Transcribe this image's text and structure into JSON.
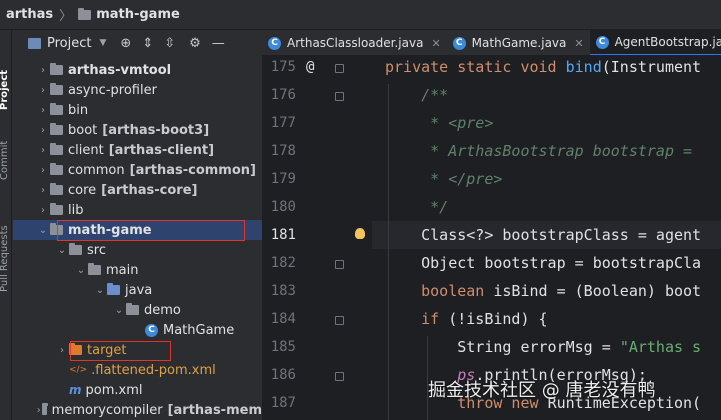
{
  "breadcrumb": {
    "root": "arthas",
    "sep": "〉",
    "module": "math-game"
  },
  "side_stripe": {
    "project": "Project",
    "commit": "Commit",
    "pull_requests": "Pull Requests"
  },
  "project_panel": {
    "title": "Project"
  },
  "tree": [
    {
      "label": "arthas-vmtool",
      "suffix": "",
      "arrow": "›",
      "icon": "folder",
      "indent": 1,
      "bold": true
    },
    {
      "label": "async-profiler",
      "suffix": "",
      "arrow": "›",
      "icon": "folder",
      "indent": 1,
      "bold": false
    },
    {
      "label": "bin",
      "suffix": "",
      "arrow": "›",
      "icon": "folder",
      "indent": 1,
      "bold": false
    },
    {
      "label": "boot",
      "suffix": "[arthas-boot3]",
      "arrow": "›",
      "icon": "folder",
      "indent": 1,
      "bold": false
    },
    {
      "label": "client",
      "suffix": "[arthas-client]",
      "arrow": "›",
      "icon": "folder",
      "indent": 1,
      "bold": false
    },
    {
      "label": "common",
      "suffix": "[arthas-common]",
      "arrow": "›",
      "icon": "folder",
      "indent": 1,
      "bold": false
    },
    {
      "label": "core",
      "suffix": "[arthas-core]",
      "arrow": "›",
      "icon": "folder",
      "indent": 1,
      "bold": false
    },
    {
      "label": "lib",
      "suffix": "",
      "arrow": "›",
      "icon": "folder",
      "indent": 1,
      "bold": false
    },
    {
      "label": "math-game",
      "suffix": "",
      "arrow": "⌄",
      "icon": "folder",
      "indent": 1,
      "bold": true,
      "selected": true
    },
    {
      "label": "src",
      "suffix": "",
      "arrow": "⌄",
      "icon": "folder",
      "indent": 2,
      "bold": false
    },
    {
      "label": "main",
      "suffix": "",
      "arrow": "⌄",
      "icon": "folder",
      "indent": 3,
      "bold": false
    },
    {
      "label": "java",
      "suffix": "",
      "arrow": "⌄",
      "icon": "folder-blue",
      "indent": 4,
      "bold": false
    },
    {
      "label": "demo",
      "suffix": "",
      "arrow": "⌄",
      "icon": "package",
      "indent": 5,
      "bold": false
    },
    {
      "label": "MathGame",
      "suffix": "",
      "arrow": "",
      "icon": "class",
      "indent": 6,
      "bold": false
    },
    {
      "label": "target",
      "suffix": "",
      "arrow": "›",
      "icon": "folder-orange",
      "indent": 2,
      "bold": false,
      "excluded": true
    },
    {
      "label": ".flattened-pom.xml",
      "suffix": "",
      "arrow": "",
      "icon": "xml",
      "indent": 2,
      "bold": false,
      "excluded": true
    },
    {
      "label": "pom.xml",
      "suffix": "",
      "arrow": "",
      "icon": "maven",
      "indent": 2,
      "bold": false
    },
    {
      "label": "memorycompiler",
      "suffix": "[arthas-mem",
      "arrow": "›",
      "icon": "folder",
      "indent": 1,
      "bold": false
    }
  ],
  "tabs": [
    {
      "label": "ArthasClassloader.java",
      "active": false
    },
    {
      "label": "MathGame.java",
      "active": false
    },
    {
      "label": "AgentBootstrap.java",
      "active": true
    }
  ],
  "line_numbers": [
    "175",
    "176",
    "177",
    "178",
    "179",
    "180",
    "181",
    "182",
    "183",
    "184",
    "185",
    "186",
    "187"
  ],
  "current_line": "181",
  "code_lines": [
    [
      {
        "t": "private static void ",
        "c": "kw"
      },
      {
        "t": "bind",
        "c": "fn"
      },
      {
        "t": "(Instrument",
        "c": ""
      }
    ],
    [
      {
        "t": "    /**",
        "c": "doc"
      }
    ],
    [
      {
        "t": "     * <pre>",
        "c": "doc"
      }
    ],
    [
      {
        "t": "     * ArthasBootstrap bootstrap = ",
        "c": "doc"
      }
    ],
    [
      {
        "t": "     * </pre>",
        "c": "doc"
      }
    ],
    [
      {
        "t": "     */",
        "c": "doc"
      }
    ],
    [
      {
        "t": "    Class<?> bootstrapClass = agent",
        "c": ""
      }
    ],
    [
      {
        "t": "    Object bootstrap = bootstrapCla",
        "c": ""
      }
    ],
    [
      {
        "t": "    boolean ",
        "c": "kw"
      },
      {
        "t": "isBind = (Boolean) boot",
        "c": ""
      }
    ],
    [
      {
        "t": "    if ",
        "c": "kw"
      },
      {
        "t": "(!isBind) {",
        "c": ""
      }
    ],
    [
      {
        "t": "        String errorMsg = ",
        "c": ""
      },
      {
        "t": "\"Arthas s",
        "c": "str"
      }
    ],
    [
      {
        "t": "        ",
        "c": ""
      },
      {
        "t": "ps",
        "c": "fld"
      },
      {
        "t": ".println(errorMsg);",
        "c": ""
      }
    ],
    [
      {
        "t": "        throw new ",
        "c": "kw"
      },
      {
        "t": "RuntimeException(",
        "c": ""
      }
    ]
  ],
  "watermark": "掘金技术社区 @ 唐老没有鸭"
}
